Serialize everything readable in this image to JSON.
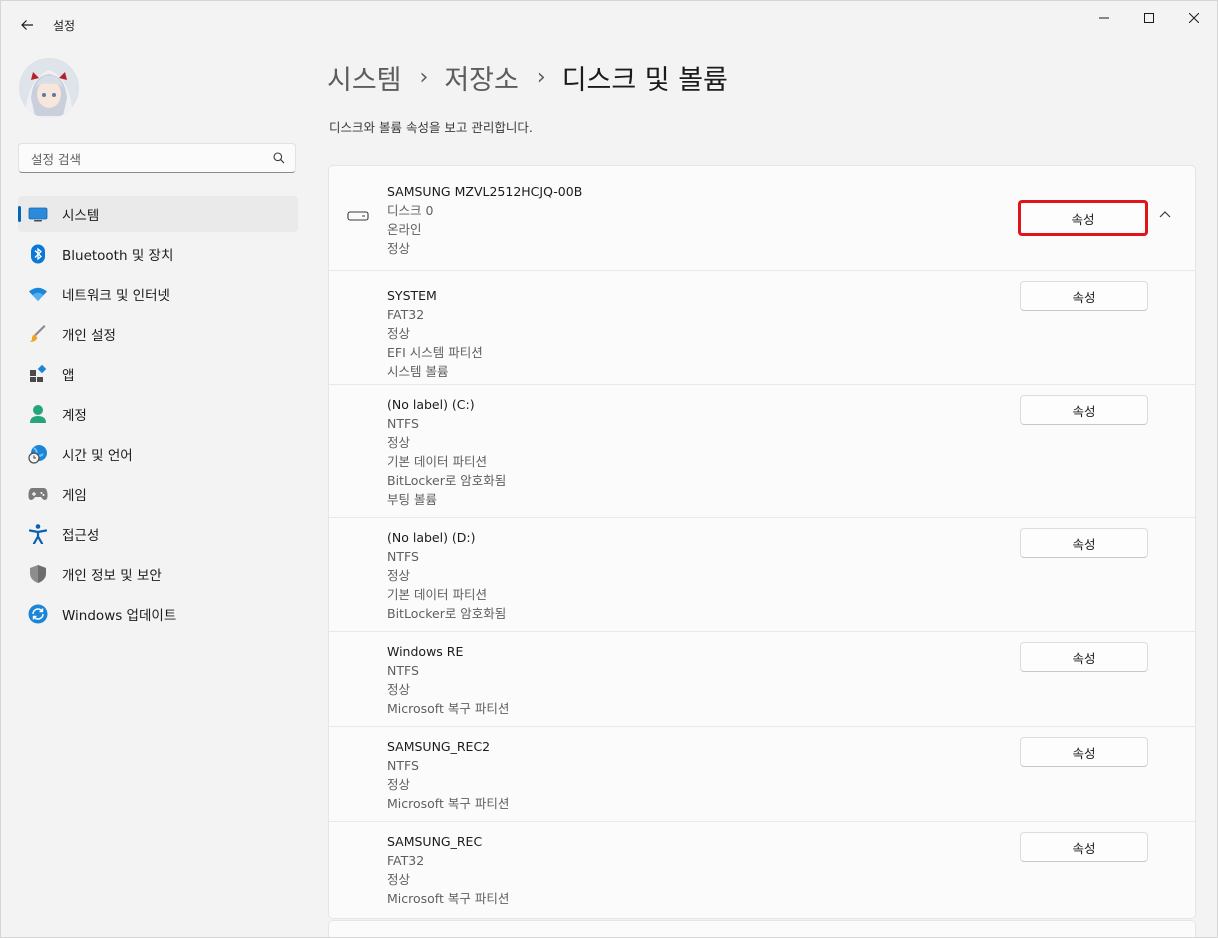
{
  "window": {
    "title": "설정"
  },
  "search": {
    "placeholder": "설정 검색"
  },
  "sidebar": {
    "items": [
      {
        "label": "시스템",
        "icon": "system-icon",
        "active": true
      },
      {
        "label": "Bluetooth 및 장치",
        "icon": "bluetooth-icon"
      },
      {
        "label": "네트워크 및 인터넷",
        "icon": "wifi-icon"
      },
      {
        "label": "개인 설정",
        "icon": "brush-icon"
      },
      {
        "label": "앱",
        "icon": "apps-icon"
      },
      {
        "label": "계정",
        "icon": "account-icon"
      },
      {
        "label": "시간 및 언어",
        "icon": "time-language-icon"
      },
      {
        "label": "게임",
        "icon": "gamepad-icon"
      },
      {
        "label": "접근성",
        "icon": "accessibility-icon"
      },
      {
        "label": "개인 정보 및 보안",
        "icon": "shield-icon"
      },
      {
        "label": "Windows 업데이트",
        "icon": "update-icon"
      }
    ]
  },
  "breadcrumb": {
    "level1": "시스템",
    "level2": "저장소",
    "current": "디스크 및 볼륨"
  },
  "subtitle": "디스크와 볼륨 속성을 보고 관리합니다.",
  "disk": {
    "name": "SAMSUNG MZVL2512HCJQ-00B",
    "details": [
      "디스크 0",
      "온라인",
      "정상"
    ],
    "button": "속성"
  },
  "partitions": [
    {
      "lines": [
        "SYSTEM",
        "FAT32",
        "정상",
        "EFI 시스템 파티션",
        "시스템 볼륨"
      ],
      "button": "속성"
    },
    {
      "lines": [
        "(No label) (C:)",
        "NTFS",
        "정상",
        "기본 데이터 파티션",
        "BitLocker로 암호화됨",
        "부팅 볼륨"
      ],
      "button": "속성"
    },
    {
      "lines": [
        "(No label) (D:)",
        "NTFS",
        "정상",
        "기본 데이터 파티션",
        "BitLocker로 암호화됨"
      ],
      "button": "속성"
    },
    {
      "lines": [
        "Windows RE",
        "NTFS",
        "정상",
        "Microsoft 복구 파티션"
      ],
      "button": "속성"
    },
    {
      "lines": [
        "SAMSUNG_REC2",
        "NTFS",
        "정상",
        "Microsoft 복구 파티션"
      ],
      "button": "속성"
    },
    {
      "lines": [
        "SAMSUNG_REC",
        "FAT32",
        "정상",
        "Microsoft 복구 파티션"
      ],
      "button": "속성"
    }
  ],
  "colors": {
    "accent": "#0067c0",
    "highlight": "#e0141b"
  }
}
